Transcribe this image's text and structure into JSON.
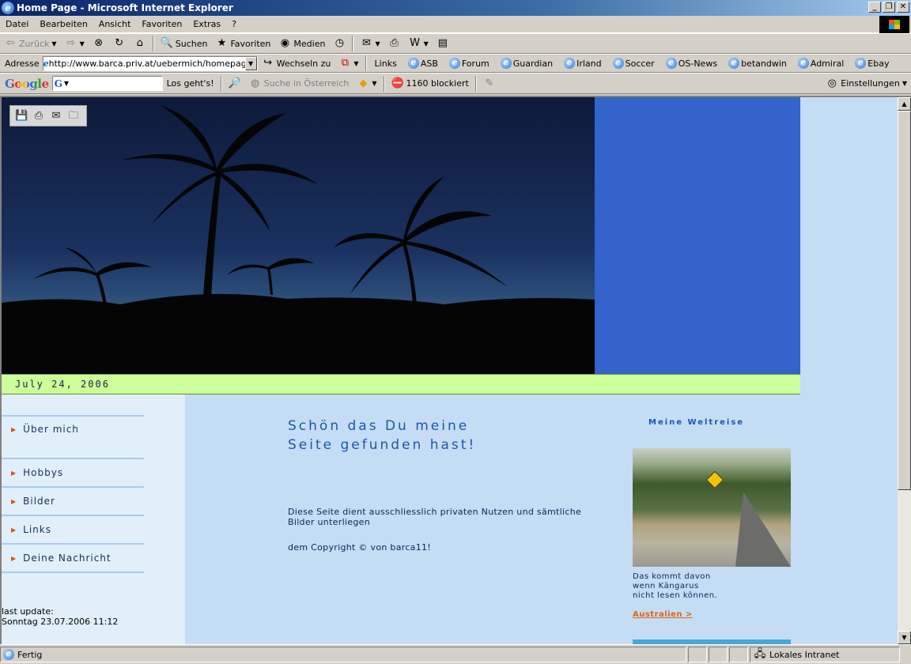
{
  "window": {
    "title": "Home Page - Microsoft Internet Explorer"
  },
  "menu": [
    "Datei",
    "Bearbeiten",
    "Ansicht",
    "Favoriten",
    "Extras",
    "?"
  ],
  "toolbar": {
    "back": "Zurück",
    "search": "Suchen",
    "favorites": "Favoriten",
    "media": "Medien"
  },
  "address": {
    "label": "Adresse",
    "url": "http://www.barca.priv.at/uebermich/homepage.h",
    "go": "Wechseln zu",
    "links_label": "Links",
    "links": [
      "ASB",
      "Forum",
      "Guardian",
      "Irland",
      "Soccer",
      "OS-News",
      "betandwin",
      "Admiral",
      "Ebay"
    ]
  },
  "google": {
    "logo": "Google",
    "go_button": "Los geht's!",
    "search_austria": "Suche in Österreich",
    "blocked": "1160 blockiert",
    "settings": "Einstellungen"
  },
  "page": {
    "date": "July 24, 2006",
    "nav": [
      "Über mich",
      "Hobbys",
      "Bilder",
      "Links",
      "Deine Nachricht"
    ],
    "last_update_label": "last update:",
    "last_update_value": "Sonntag 23.07.2006 11:12",
    "title_line1": "Schön das Du meine",
    "title_line2": "Seite gefunden hast!",
    "body_line1": "Diese Seite dient ausschliesslich privaten Nutzen und sämtliche Bilder unterliegen",
    "body_line2": "dem Copyright © von barca11!",
    "side_title": "Meine Weltreise",
    "caption_line1": "Das kommt davon",
    "caption_line2": "wenn Kängarus",
    "caption_line3": "nicht lesen können.",
    "side_link": "Australien >"
  },
  "status": {
    "left": "Fertig",
    "zone": "Lokales Intranet"
  },
  "colors": {
    "accent_blue": "#3364cc",
    "date_bar": "#ccff99",
    "link_orange": "#e06410"
  }
}
